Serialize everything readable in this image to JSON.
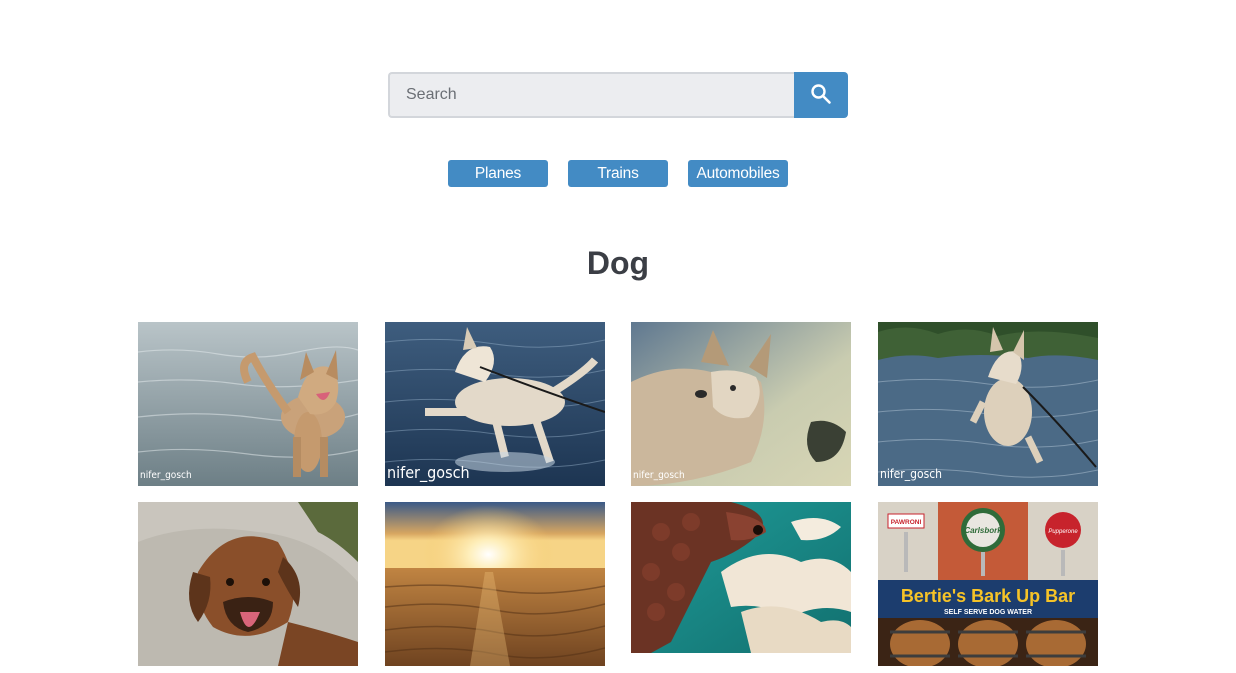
{
  "search": {
    "placeholder": "Search",
    "value": "",
    "button_icon": "search-icon"
  },
  "nav": {
    "items": [
      {
        "label": "Planes"
      },
      {
        "label": "Trains"
      },
      {
        "label": "Automobiles"
      }
    ]
  },
  "main": {
    "title": "Dog"
  },
  "gallery": {
    "images": [
      {
        "subject": "dog standing in lake",
        "watermark": "nifer_gosch"
      },
      {
        "subject": "dog running in water on leash",
        "watermark": "nifer_gosch"
      },
      {
        "subject": "dog head by water",
        "watermark": "nifer_gosch"
      },
      {
        "subject": "dog jumping in river",
        "watermark": "nifer_gosch"
      },
      {
        "subject": "dog lying on rock",
        "watermark": ""
      },
      {
        "subject": "sunset over sand beach",
        "watermark": ""
      },
      {
        "subject": "poodle against sky",
        "watermark": ""
      },
      {
        "subject": "bar sign with beer taps",
        "watermark": "",
        "sign_text": "Bertie's Bark Up Bar",
        "sign_subtext": "SELF SERVE DOG WATER",
        "tap_labels": [
          "PAWRONI",
          "Carlsbork",
          "Pupperone"
        ]
      }
    ]
  },
  "colors": {
    "accent": "#438bc4",
    "title": "#3b3e45",
    "input_bg": "#ecedf0"
  }
}
